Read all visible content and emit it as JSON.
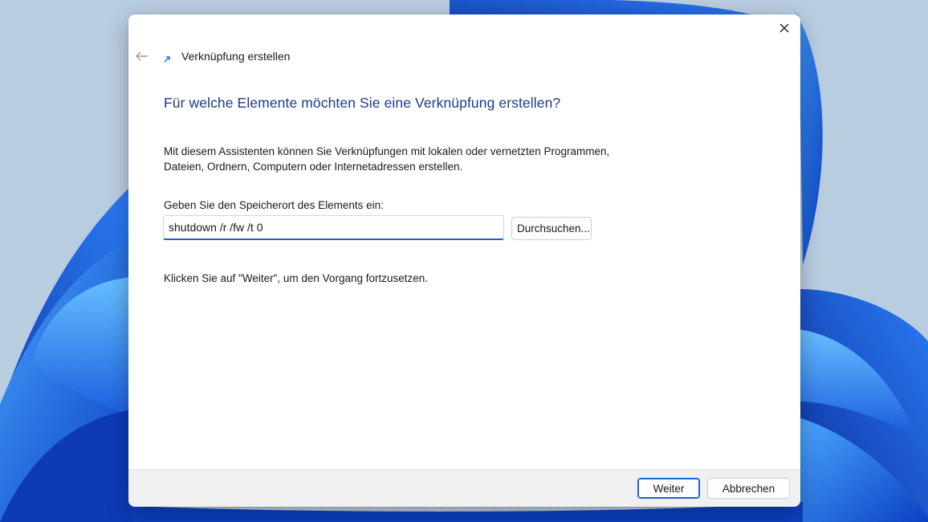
{
  "window": {
    "title": "Verknüpfung erstellen",
    "close_icon": "close-icon",
    "back_icon": "arrow-left-icon",
    "title_icon": "shortcut-wizard-icon"
  },
  "content": {
    "heading": "Für welche Elemente möchten Sie eine Verknüpfung erstellen?",
    "description": "Mit diesem Assistenten können Sie Verknüpfungen mit lokalen oder vernetzten Programmen, Dateien, Ordnern, Computern oder Internetadressen erstellen.",
    "location_label": "Geben Sie den Speicherort des Elements ein:",
    "location_value": "shutdown /r /fw /t 0",
    "browse_label": "Durchsuchen...",
    "instruction": "Klicken Sie auf \"Weiter\", um den Vorgang fortzusetzen."
  },
  "footer": {
    "next_label": "Weiter",
    "cancel_label": "Abbrechen"
  },
  "colors": {
    "heading": "#1e3a8a",
    "accent": "#1f63c9",
    "wallpaper_bg": "#b9cde0",
    "bloom": "#1f5fd6"
  }
}
